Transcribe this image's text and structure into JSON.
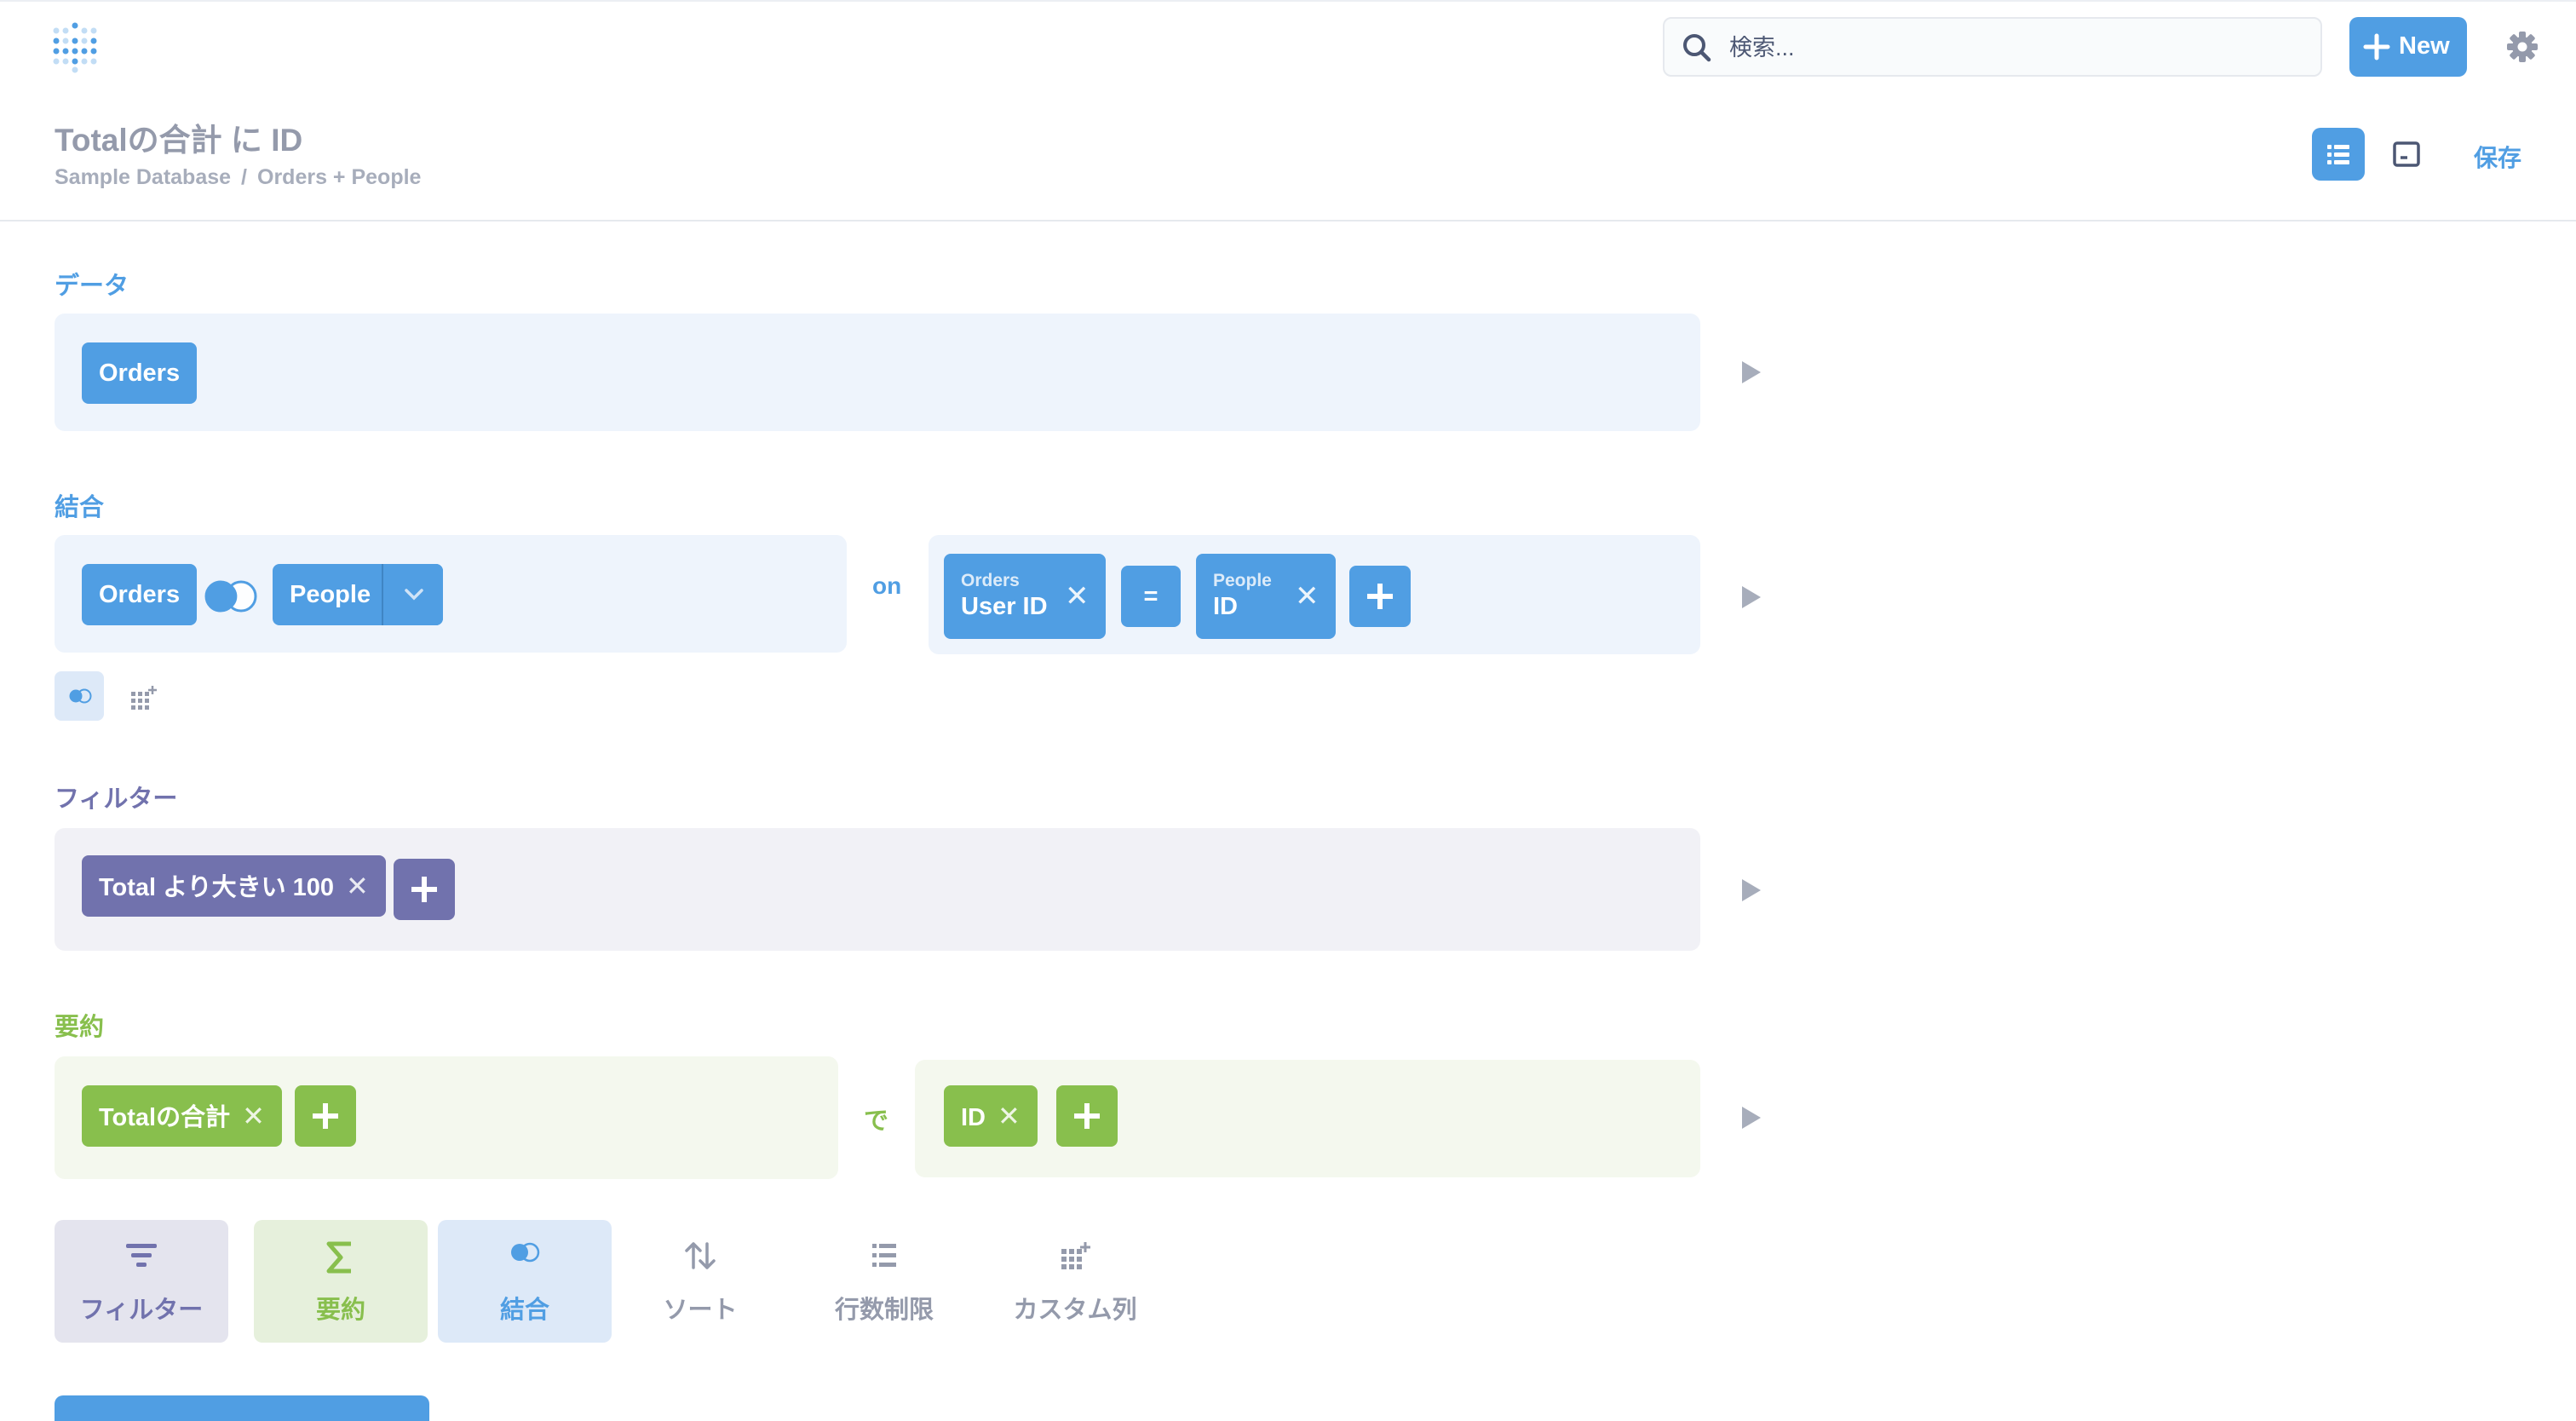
{
  "search": {
    "placeholder": "検索..."
  },
  "topbar": {
    "new_label": "New"
  },
  "header": {
    "title": "Totalの合計 に ID",
    "breadcrumb": [
      "Sample Database",
      "Orders + People"
    ],
    "save_label": "保存"
  },
  "data_section": {
    "label": "データ",
    "table": "Orders"
  },
  "join_section": {
    "label": "結合",
    "left_table": "Orders",
    "right_table": "People",
    "on_label": "on",
    "left_column": {
      "table": "Orders",
      "column": "User ID"
    },
    "operator": "=",
    "right_column": {
      "table": "People",
      "column": "ID"
    }
  },
  "filter_section": {
    "label": "フィルター",
    "filter": "Total より大きい 100"
  },
  "summarize_section": {
    "label": "要約",
    "metric": "Totalの合計",
    "by_label": "で",
    "breakout": "ID"
  },
  "actions": [
    {
      "label": "フィルター"
    },
    {
      "label": "要約"
    },
    {
      "label": "結合"
    },
    {
      "label": "ソート"
    },
    {
      "label": "行数制限"
    },
    {
      "label": "カスタム列"
    }
  ],
  "colors": {
    "brand": "#509ee3",
    "filter": "#7172ad",
    "summarize": "#88bf4d"
  }
}
